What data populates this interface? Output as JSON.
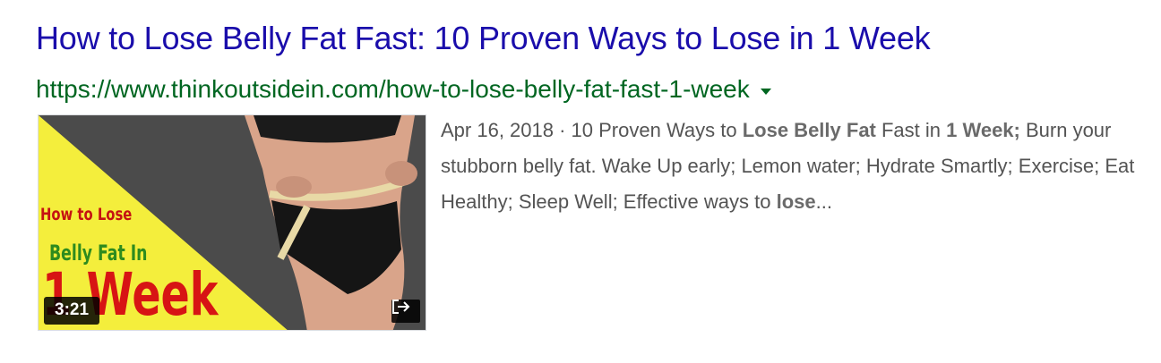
{
  "result": {
    "title": "How to Lose Belly Fat Fast: 10 Proven Ways to Lose in 1 Week",
    "url": "https://www.thinkoutsidein.com/how-to-lose-belly-fat-fast-1-week",
    "thumbnail": {
      "line1": "How to Lose",
      "line2": "Belly Fat In",
      "line3": "1 Week",
      "duration": "3:21",
      "external_icon": "open-external-icon"
    },
    "snippet": {
      "date": "Apr 16, 2018",
      "separator": " · ",
      "p1": "10 Proven Ways to ",
      "b1": "Lose Belly Fat",
      "p2": " Fast in ",
      "b2": "1 Week;",
      "p3": " Burn your stubborn belly fat. Wake Up early; Lemon water; Hydrate Smartly; Exercise; Eat Healthy; Sleep Well; Effective ways to ",
      "b3": "lose",
      "ellipsis": "..."
    }
  },
  "colors": {
    "title": "#1a0dab",
    "url": "#006621",
    "snippet": "#545454",
    "thumb_yellow": "#f4ee3c",
    "thumb_gray": "#4b4b4b"
  }
}
